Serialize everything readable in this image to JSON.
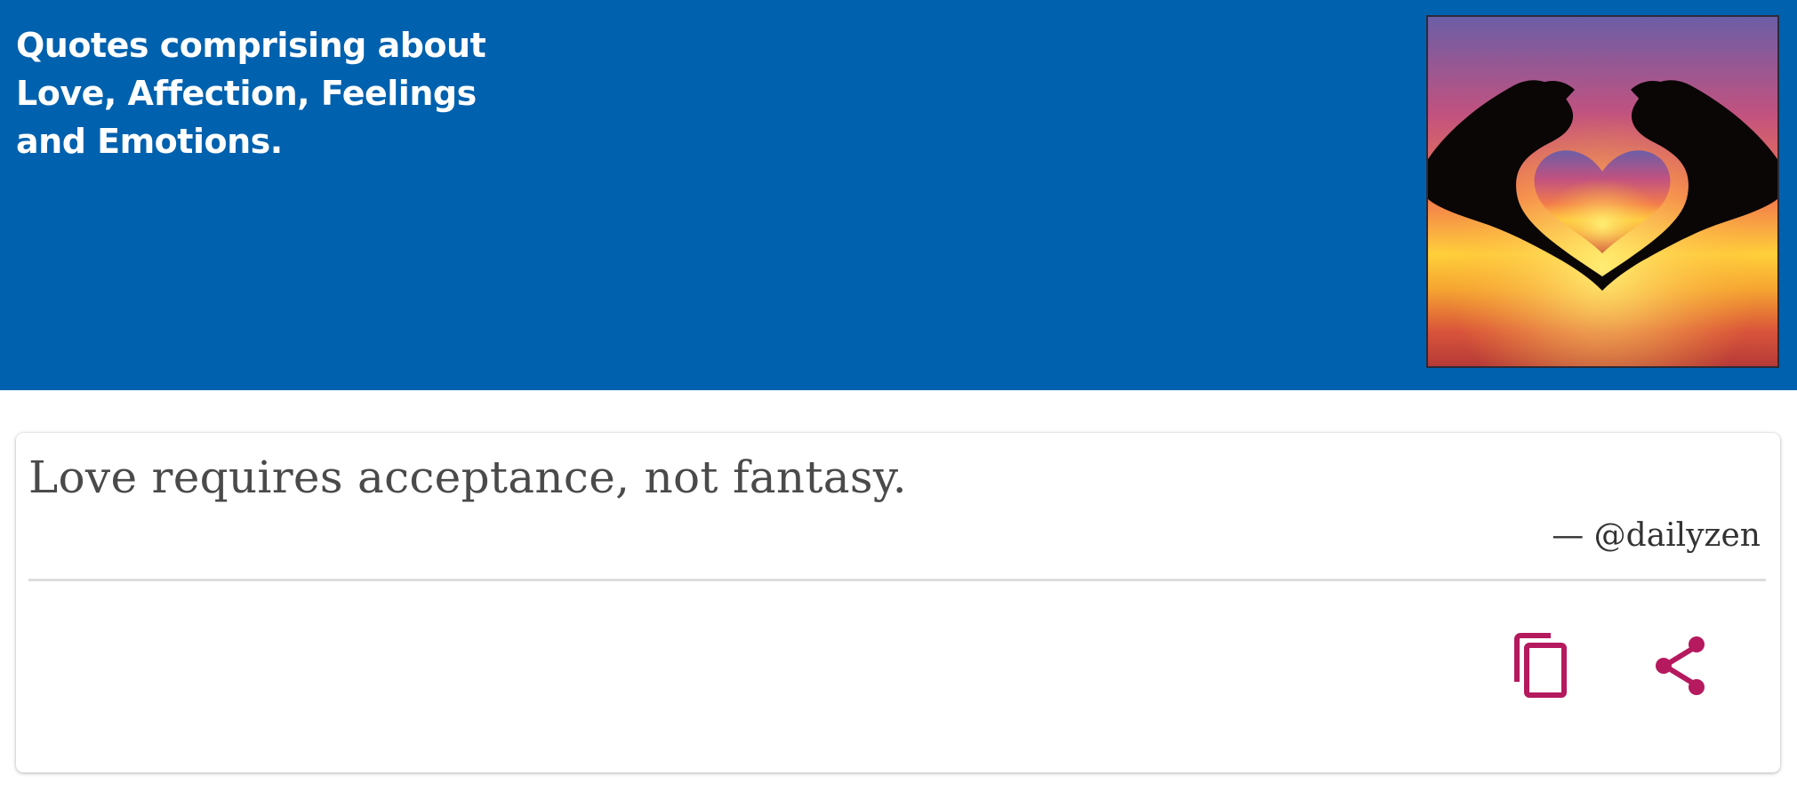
{
  "header": {
    "description": "Quotes comprising about Love, Affection, Feelings and Emotions.",
    "image_icon": "heart-hands-sunset-image",
    "background_color": "#0061ae"
  },
  "quote_card": {
    "text": "Love requires acceptance, not fantasy.",
    "author": "— @dailyzen",
    "actions": [
      {
        "icon": "copy-icon"
      },
      {
        "icon": "share-icon"
      }
    ],
    "icon_color": "#b5195e"
  }
}
